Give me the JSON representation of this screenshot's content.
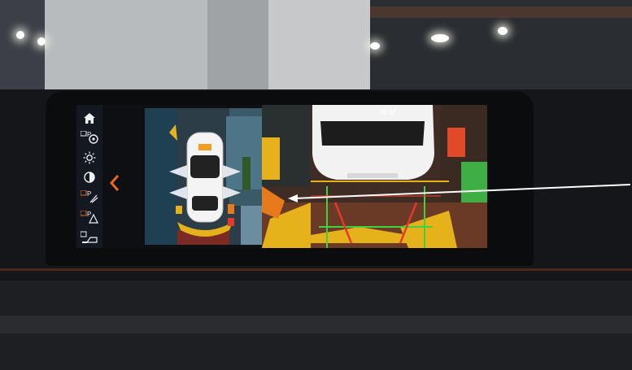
{
  "sidebar": {
    "items": [
      {
        "icon": "home-icon"
      },
      {
        "icon": "park-distance-control-icon"
      },
      {
        "icon": "brightness-icon"
      },
      {
        "icon": "contrast-icon"
      },
      {
        "icon": "parking-assist-icon"
      },
      {
        "icon": "parking-warning-icon"
      },
      {
        "icon": "panorama-view-icon"
      }
    ]
  },
  "back": {
    "icon": "chevron-left-icon"
  },
  "rear_camera": {
    "label": "rear"
  },
  "colors": {
    "accent": "#e86a1c",
    "guide_red": "#e33a2a",
    "guide_green": "#3ed23e",
    "zone_yellow": "#e6b21c",
    "zone_orange": "#e87a1e",
    "pointer_line": "#ffffff"
  }
}
